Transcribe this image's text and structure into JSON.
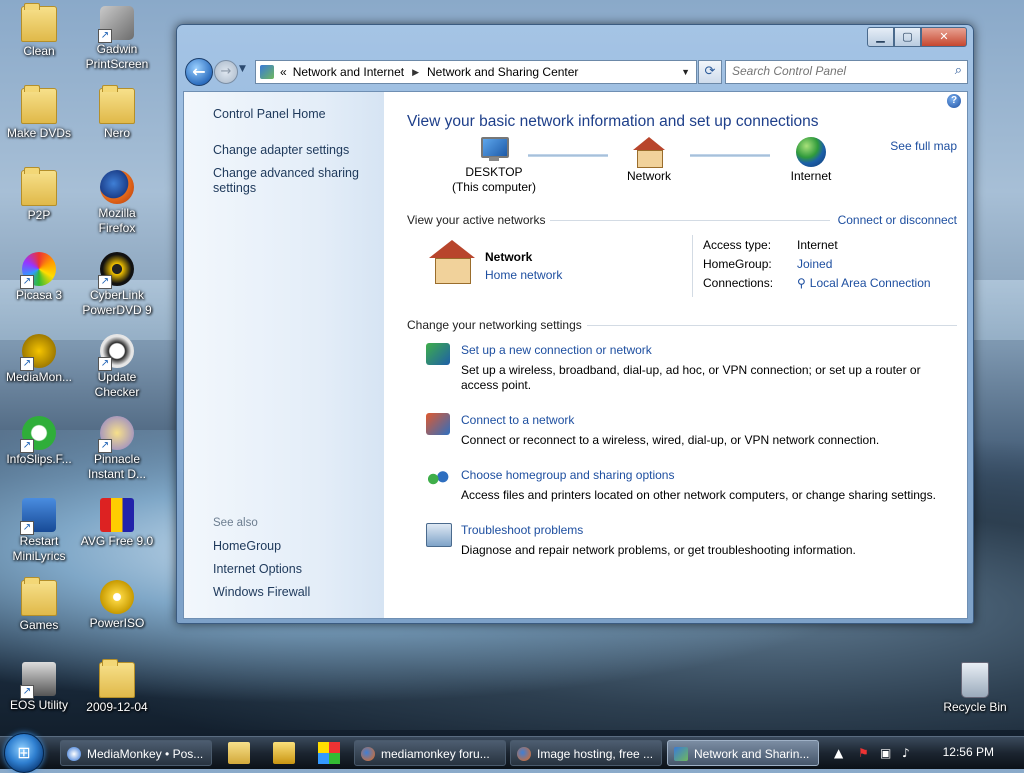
{
  "desktop": {
    "icons": [
      {
        "label": "Clean"
      },
      {
        "label": "Gadwin PrintScreen"
      },
      {
        "label": "Make DVDs"
      },
      {
        "label": "Nero"
      },
      {
        "label": "P2P"
      },
      {
        "label": "Mozilla Firefox"
      },
      {
        "label": "Picasa 3"
      },
      {
        "label": "CyberLink PowerDVD 9"
      },
      {
        "label": "MediaMon..."
      },
      {
        "label": "Update Checker"
      },
      {
        "label": "InfoSlips.F..."
      },
      {
        "label": "Pinnacle Instant D..."
      },
      {
        "label": "Restart MiniLyrics"
      },
      {
        "label": "AVG Free 9.0"
      },
      {
        "label": "Games"
      },
      {
        "label": "PowerISO"
      },
      {
        "label": "EOS Utility"
      },
      {
        "label": "2009-12-04"
      },
      {
        "label": "Recycle Bin"
      }
    ]
  },
  "window": {
    "address": {
      "chevron": "«",
      "crumbs": [
        "Network and Internet",
        "Network and Sharing Center"
      ]
    },
    "search_placeholder": "Search Control Panel",
    "left_pane": {
      "home": "Control Panel Home",
      "links": [
        "Change adapter settings",
        "Change advanced sharing settings"
      ],
      "see_also_label": "See also",
      "see_also": [
        "HomeGroup",
        "Internet Options",
        "Windows Firewall"
      ]
    },
    "main": {
      "title": "View your basic network information and set up connections",
      "see_full_map": "See full map",
      "map": {
        "computer_name": "DESKTOP",
        "computer_sub": "(This computer)",
        "network": "Network",
        "internet": "Internet"
      },
      "active_networks_label": "View your active networks",
      "connect_or_disconnect": "Connect or disconnect",
      "active_network": {
        "name": "Network",
        "type": "Home network",
        "access_type_label": "Access type:",
        "access_type_value": "Internet",
        "homegroup_label": "HomeGroup:",
        "homegroup_value": "Joined",
        "connections_label": "Connections:",
        "connections_value": "Local Area Connection"
      },
      "change_settings_label": "Change your networking settings",
      "tasks": [
        {
          "title": "Set up a new connection or network",
          "desc": "Set up a wireless, broadband, dial-up, ad hoc, or VPN connection; or set up a router or access point."
        },
        {
          "title": "Connect to a network",
          "desc": "Connect or reconnect to a wireless, wired, dial-up, or VPN network connection."
        },
        {
          "title": "Choose homegroup and sharing options",
          "desc": "Access files and printers located on other network computers, or change sharing settings."
        },
        {
          "title": "Troubleshoot problems",
          "desc": "Diagnose and repair network problems, or get troubleshooting information."
        }
      ]
    }
  },
  "taskbar": {
    "buttons": [
      {
        "label": "MediaMonkey • Pos..."
      },
      {
        "label": "mediamonkey foru..."
      },
      {
        "label": "Image hosting, free ..."
      },
      {
        "label": "Network and Sharin..."
      }
    ],
    "clock": "12:56 PM"
  }
}
